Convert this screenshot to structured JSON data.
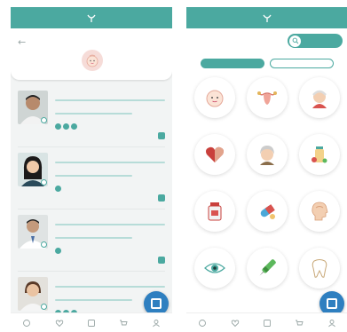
{
  "colors": {
    "brand": "#4ba9a0",
    "fab": "#2e7fc0",
    "background": "#f2f4f4"
  },
  "left_screen": {
    "header_title": "",
    "department_icon": "baby-face-icon",
    "doctors": [
      {
        "name": "",
        "specialty": "",
        "schedule": "",
        "day_count": 3
      },
      {
        "name": "",
        "specialty": "",
        "schedule": "",
        "day_count": 1
      },
      {
        "name": "",
        "specialty": "",
        "schedule": "",
        "day_count": 1
      },
      {
        "name": "",
        "specialty": "",
        "schedule": "",
        "day_count": 3
      }
    ]
  },
  "right_screen": {
    "search_label": "",
    "tabs": [
      {
        "label": ""
      },
      {
        "label": ""
      }
    ],
    "categories": [
      {
        "icon": "baby-face-icon",
        "label": ""
      },
      {
        "icon": "uterus-icon",
        "label": ""
      },
      {
        "icon": "elderly-person-icon",
        "label": ""
      },
      {
        "icon": "heart-icon",
        "label": ""
      },
      {
        "icon": "elderly-woman-icon",
        "label": ""
      },
      {
        "icon": "pills-bottle-icon",
        "label": ""
      },
      {
        "icon": "medicine-bottle-icon",
        "label": ""
      },
      {
        "icon": "capsule-icon",
        "label": ""
      },
      {
        "icon": "head-profile-icon",
        "label": ""
      },
      {
        "icon": "eye-icon",
        "label": ""
      },
      {
        "icon": "syringe-pen-icon",
        "label": ""
      },
      {
        "icon": "tooth-icon",
        "label": ""
      }
    ]
  },
  "bottom_nav": [
    "home-icon",
    "heart-pulse-icon",
    "schedule-icon",
    "cart-icon",
    "profile-icon"
  ]
}
